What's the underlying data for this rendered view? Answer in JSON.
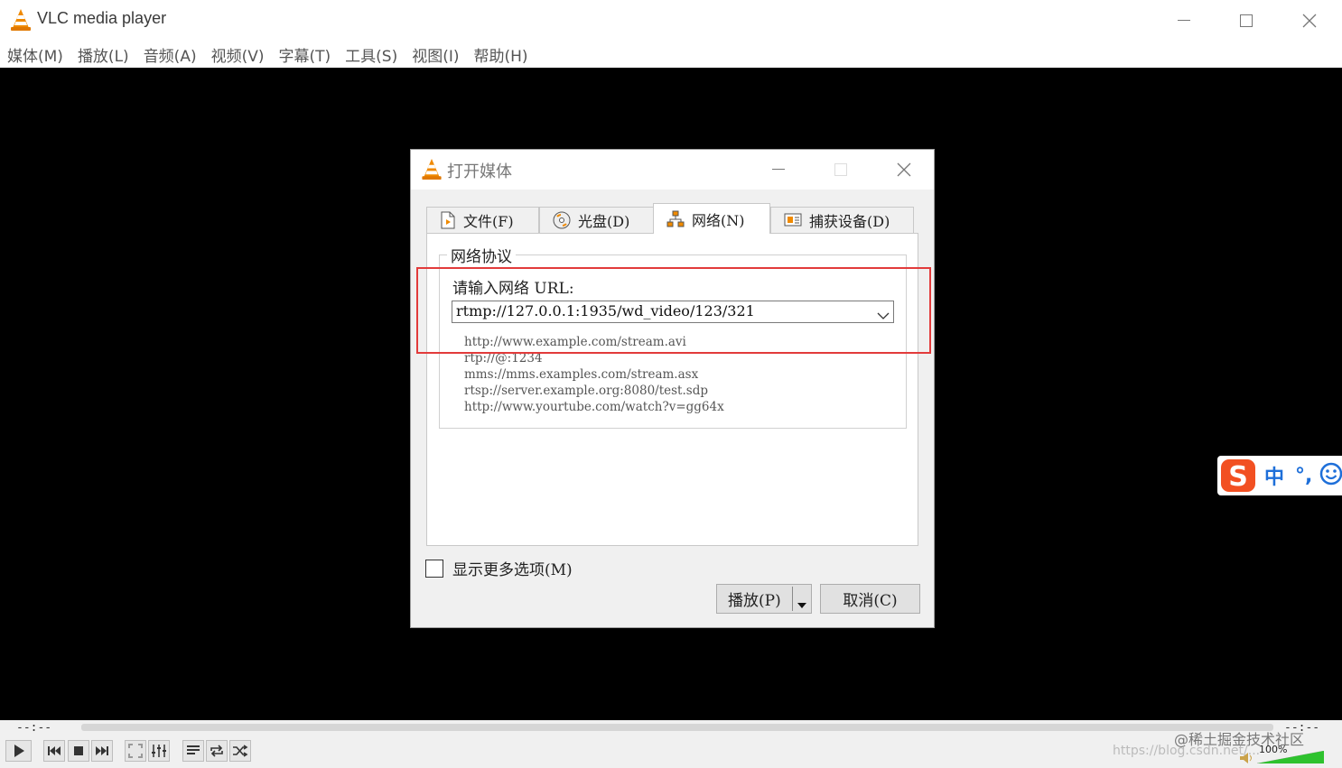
{
  "window": {
    "title": "VLC media player"
  },
  "menu": [
    "媒体(M)",
    "播放(L)",
    "音频(A)",
    "视频(V)",
    "字幕(T)",
    "工具(S)",
    "视图(I)",
    "帮助(H)"
  ],
  "dialog": {
    "title": "打开媒体",
    "tabs": [
      {
        "label": "文件(F)",
        "icon": "file-icon"
      },
      {
        "label": "光盘(D)",
        "icon": "disc-icon"
      },
      {
        "label": "网络(N)",
        "icon": "network-icon",
        "active": true
      },
      {
        "label": "捕获设备(D)",
        "icon": "capture-icon"
      }
    ],
    "group_title": "网络协议",
    "url_label": "请输入网络 URL:",
    "url_value": "rtmp://127.0.0.1:1935/wd_video/123/321",
    "examples": [
      "http://www.example.com/stream.avi",
      "rtp://@:1234",
      "mms://mms.examples.com/stream.asx",
      "rtsp://server.example.org:8080/test.sdp",
      "http://www.yourtube.com/watch?v=gg64x"
    ],
    "show_more": "显示更多选项(M)",
    "play_button": "播放(P)",
    "cancel_button": "取消(C)"
  },
  "player": {
    "time_elapsed": "--:--",
    "time_total": "--:--",
    "volume_label": "100%",
    "volume_level": 1.0
  },
  "ime": {
    "mode": "中",
    "punct": "°,"
  },
  "watermark": {
    "line1": "@稀土掘金技术社区",
    "line2": "https://blog.csdn.net/..."
  },
  "colors": {
    "video_bg": "#000000",
    "highlight": "#e23b3b",
    "vlc_orange": "#f08a00",
    "ime_blue": "#1e6fd9",
    "volume_green": "#2ec22e"
  }
}
